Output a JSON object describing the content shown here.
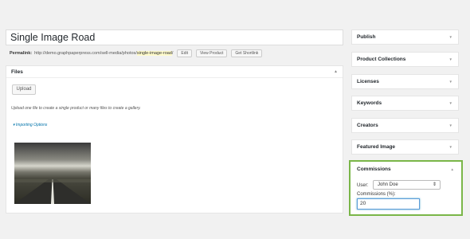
{
  "editor": {
    "title": "Single Image Road",
    "permalink_label": "Permalink:",
    "permalink_base": "http://demo.graphpaperpress.com/sell-media/photos/",
    "permalink_slug": "single-image-road",
    "permalink_end": "/",
    "edit_label": "Edit",
    "view_label": "View Product",
    "shortlink_label": "Get Shortlink"
  },
  "files": {
    "heading": "Files",
    "toggle": "▲",
    "upload_label": "Upload",
    "hint": "Upload one file to create a single product or many files to create a gallery.",
    "importing_label": "▾  Importing Options"
  },
  "sidebar": {
    "boxes": [
      {
        "label": "Publish",
        "arrow": "▼"
      },
      {
        "label": "Product Collections",
        "arrow": "▼"
      },
      {
        "label": "Licenses",
        "arrow": "▼"
      },
      {
        "label": "Keywords",
        "arrow": "▼"
      },
      {
        "label": "Creators",
        "arrow": "▼"
      },
      {
        "label": "Featured Image",
        "arrow": "▼"
      }
    ],
    "commissions": {
      "heading": "Commissions",
      "arrow": "▲",
      "user_label": "User:",
      "user_value": "John Doe",
      "caret": "⇕",
      "commission_label": "Commissions (%):",
      "commission_value": "20"
    }
  },
  "colors": {
    "highlight_border": "#7ab648",
    "link": "#0073aa",
    "slug_bg": "#fffbcc"
  }
}
